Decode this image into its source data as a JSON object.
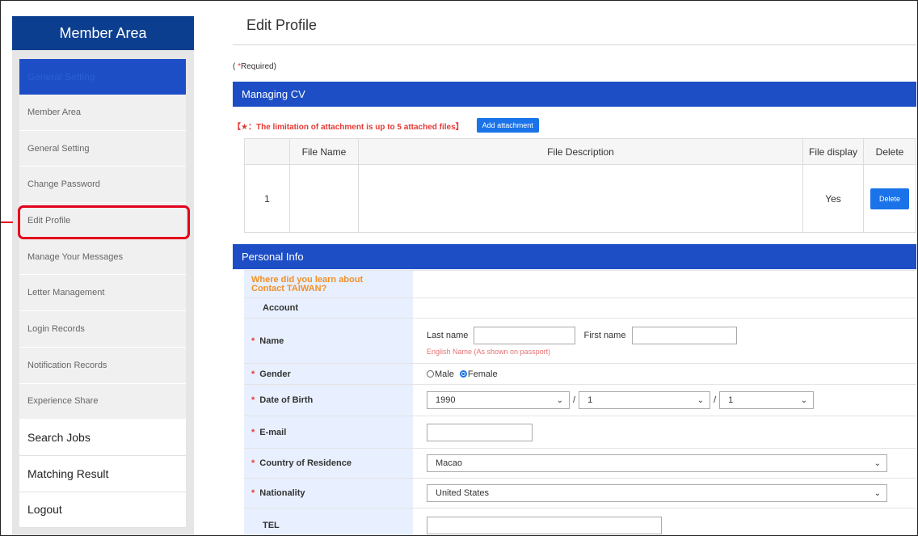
{
  "sidebar": {
    "title": "Member Area",
    "active_header": "General Setting",
    "items": [
      {
        "label": "Member Area"
      },
      {
        "label": "General Setting"
      },
      {
        "label": "Change Password"
      },
      {
        "label": "Edit Profile"
      },
      {
        "label": "Manage Your Messages"
      },
      {
        "label": "Letter Management"
      },
      {
        "label": "Login Records"
      },
      {
        "label": "Notification Records"
      },
      {
        "label": "Experience Share"
      }
    ],
    "main_items": [
      {
        "label": "Search Jobs"
      },
      {
        "label": "Matching Result"
      },
      {
        "label": "Logout"
      }
    ]
  },
  "page": {
    "title": "Edit Profile",
    "required_prefix": "( ",
    "required_star": "*",
    "required_suffix": "Required)"
  },
  "cv": {
    "section_title": "Managing CV",
    "limit_text": "【★：The limitation of attachment is up to 5 attached files】",
    "add_button": "Add attachment",
    "headers": [
      "",
      "File Name",
      "File Description",
      "File display",
      "Delete"
    ],
    "rows": [
      {
        "index": "1",
        "file_name": "",
        "description": "",
        "display": "Yes",
        "delete_label": "Delete"
      }
    ]
  },
  "personal": {
    "section_title": "Personal Info",
    "where_label": "Where did you learn about Contact TAIWAN?",
    "account_label": "Account",
    "name_label": "Name",
    "last_name_label": "Last name",
    "first_name_label": "First name",
    "name_hint": "English Name (As shown on passport)",
    "gender_label": "Gender",
    "gender_male": "Male",
    "gender_female": "Female",
    "gender_selected": "Female",
    "dob_label": "Date of Birth",
    "dob_year": "1990",
    "dob_month": "1",
    "dob_day": "1",
    "email_label": "E-mail",
    "country_label": "Country of Residence",
    "country_value": "Macao",
    "nationality_label": "Nationality",
    "nationality_value": "United States",
    "tel_label": "TEL",
    "required_mark": "*"
  },
  "icons": {
    "select_arrow": "chevron-down-icon",
    "radio": "radio-icon"
  },
  "colors": {
    "brand_blue": "#1d4ec5",
    "sidebar_title_blue": "#0c3e8f",
    "button_blue": "#1a73e8",
    "required_red": "#e53935",
    "highlight_red": "#e3001b",
    "label_orange": "#f0902a",
    "label_bg": "#e8efff"
  }
}
